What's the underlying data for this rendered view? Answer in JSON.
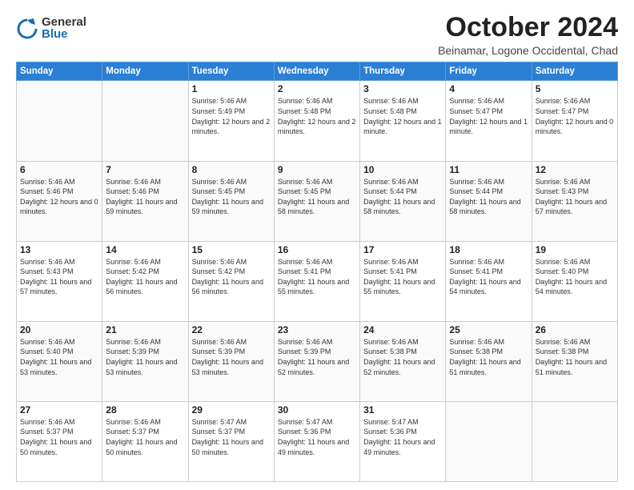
{
  "logo": {
    "general": "General",
    "blue": "Blue"
  },
  "title": "October 2024",
  "subtitle": "Beinamar, Logone Occidental, Chad",
  "days_header": [
    "Sunday",
    "Monday",
    "Tuesday",
    "Wednesday",
    "Thursday",
    "Friday",
    "Saturday"
  ],
  "weeks": [
    [
      {
        "day": "",
        "info": ""
      },
      {
        "day": "",
        "info": ""
      },
      {
        "day": "1",
        "info": "Sunrise: 5:46 AM\nSunset: 5:49 PM\nDaylight: 12 hours\nand 2 minutes."
      },
      {
        "day": "2",
        "info": "Sunrise: 5:46 AM\nSunset: 5:48 PM\nDaylight: 12 hours\nand 2 minutes."
      },
      {
        "day": "3",
        "info": "Sunrise: 5:46 AM\nSunset: 5:48 PM\nDaylight: 12 hours\nand 1 minute."
      },
      {
        "day": "4",
        "info": "Sunrise: 5:46 AM\nSunset: 5:47 PM\nDaylight: 12 hours\nand 1 minute."
      },
      {
        "day": "5",
        "info": "Sunrise: 5:46 AM\nSunset: 5:47 PM\nDaylight: 12 hours\nand 0 minutes."
      }
    ],
    [
      {
        "day": "6",
        "info": "Sunrise: 5:46 AM\nSunset: 5:46 PM\nDaylight: 12 hours\nand 0 minutes."
      },
      {
        "day": "7",
        "info": "Sunrise: 5:46 AM\nSunset: 5:46 PM\nDaylight: 11 hours\nand 59 minutes."
      },
      {
        "day": "8",
        "info": "Sunrise: 5:46 AM\nSunset: 5:45 PM\nDaylight: 11 hours\nand 59 minutes."
      },
      {
        "day": "9",
        "info": "Sunrise: 5:46 AM\nSunset: 5:45 PM\nDaylight: 11 hours\nand 58 minutes."
      },
      {
        "day": "10",
        "info": "Sunrise: 5:46 AM\nSunset: 5:44 PM\nDaylight: 11 hours\nand 58 minutes."
      },
      {
        "day": "11",
        "info": "Sunrise: 5:46 AM\nSunset: 5:44 PM\nDaylight: 11 hours\nand 58 minutes."
      },
      {
        "day": "12",
        "info": "Sunrise: 5:46 AM\nSunset: 5:43 PM\nDaylight: 11 hours\nand 57 minutes."
      }
    ],
    [
      {
        "day": "13",
        "info": "Sunrise: 5:46 AM\nSunset: 5:43 PM\nDaylight: 11 hours\nand 57 minutes."
      },
      {
        "day": "14",
        "info": "Sunrise: 5:46 AM\nSunset: 5:42 PM\nDaylight: 11 hours\nand 56 minutes."
      },
      {
        "day": "15",
        "info": "Sunrise: 5:46 AM\nSunset: 5:42 PM\nDaylight: 11 hours\nand 56 minutes."
      },
      {
        "day": "16",
        "info": "Sunrise: 5:46 AM\nSunset: 5:41 PM\nDaylight: 11 hours\nand 55 minutes."
      },
      {
        "day": "17",
        "info": "Sunrise: 5:46 AM\nSunset: 5:41 PM\nDaylight: 11 hours\nand 55 minutes."
      },
      {
        "day": "18",
        "info": "Sunrise: 5:46 AM\nSunset: 5:41 PM\nDaylight: 11 hours\nand 54 minutes."
      },
      {
        "day": "19",
        "info": "Sunrise: 5:46 AM\nSunset: 5:40 PM\nDaylight: 11 hours\nand 54 minutes."
      }
    ],
    [
      {
        "day": "20",
        "info": "Sunrise: 5:46 AM\nSunset: 5:40 PM\nDaylight: 11 hours\nand 53 minutes."
      },
      {
        "day": "21",
        "info": "Sunrise: 5:46 AM\nSunset: 5:39 PM\nDaylight: 11 hours\nand 53 minutes."
      },
      {
        "day": "22",
        "info": "Sunrise: 5:46 AM\nSunset: 5:39 PM\nDaylight: 11 hours\nand 53 minutes."
      },
      {
        "day": "23",
        "info": "Sunrise: 5:46 AM\nSunset: 5:39 PM\nDaylight: 11 hours\nand 52 minutes."
      },
      {
        "day": "24",
        "info": "Sunrise: 5:46 AM\nSunset: 5:38 PM\nDaylight: 11 hours\nand 52 minutes."
      },
      {
        "day": "25",
        "info": "Sunrise: 5:46 AM\nSunset: 5:38 PM\nDaylight: 11 hours\nand 51 minutes."
      },
      {
        "day": "26",
        "info": "Sunrise: 5:46 AM\nSunset: 5:38 PM\nDaylight: 11 hours\nand 51 minutes."
      }
    ],
    [
      {
        "day": "27",
        "info": "Sunrise: 5:46 AM\nSunset: 5:37 PM\nDaylight: 11 hours\nand 50 minutes."
      },
      {
        "day": "28",
        "info": "Sunrise: 5:46 AM\nSunset: 5:37 PM\nDaylight: 11 hours\nand 50 minutes."
      },
      {
        "day": "29",
        "info": "Sunrise: 5:47 AM\nSunset: 5:37 PM\nDaylight: 11 hours\nand 50 minutes."
      },
      {
        "day": "30",
        "info": "Sunrise: 5:47 AM\nSunset: 5:36 PM\nDaylight: 11 hours\nand 49 minutes."
      },
      {
        "day": "31",
        "info": "Sunrise: 5:47 AM\nSunset: 5:36 PM\nDaylight: 11 hours\nand 49 minutes."
      },
      {
        "day": "",
        "info": ""
      },
      {
        "day": "",
        "info": ""
      }
    ]
  ]
}
